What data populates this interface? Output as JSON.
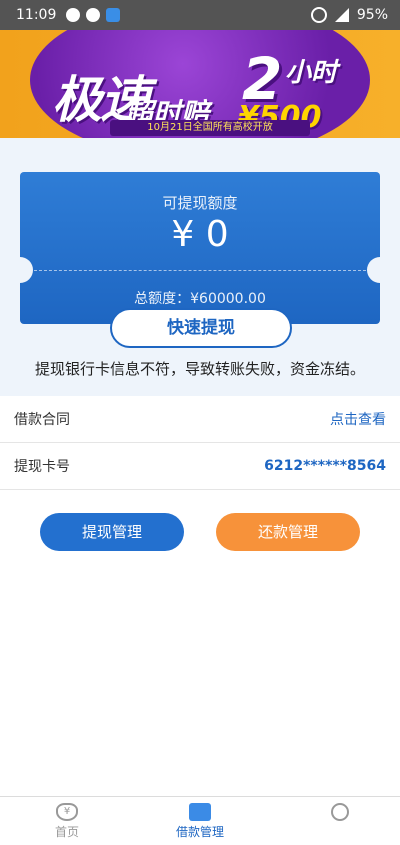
{
  "status": {
    "time": "11:09",
    "battery": "95%"
  },
  "banner": {
    "title_part1": "极速",
    "title_part2": "超时赔",
    "big_number": "2",
    "unit": "小时",
    "amount": "¥500",
    "subtitle": "10月21日全国所有高校开放"
  },
  "card": {
    "label": "可提现额度",
    "amount": "¥ 0",
    "total": "总额度：¥60000.00",
    "quick_button": "快速提现",
    "warning": "提现银行卡信息不符，导致转账失败，资金冻结。"
  },
  "rows": [
    {
      "key": "借款合同",
      "value": "点击查看"
    },
    {
      "key": "提现卡号",
      "value": "6212******8564"
    }
  ],
  "buttons": {
    "withdraw_manage": "提现管理",
    "repay_manage": "还款管理"
  },
  "tabs": {
    "home": {
      "label": "首页",
      "icon": "money-bag-icon"
    },
    "loan": {
      "label": "借款管理",
      "icon": "wallet-icon"
    }
  }
}
